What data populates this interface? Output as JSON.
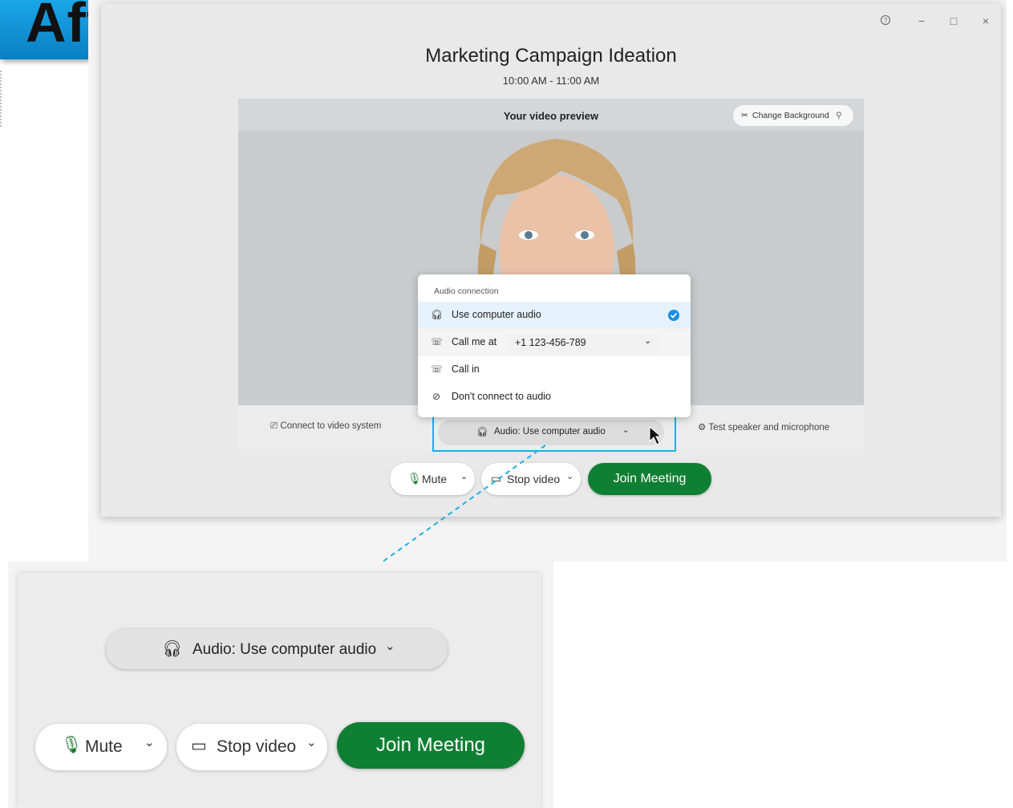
{
  "badge": {
    "text": "After"
  },
  "window": {
    "title": "Marketing Campaign Ideation",
    "time": "10:00 AM - 11:00 AM",
    "controls": {
      "help": "?",
      "minimize": "−",
      "maximize": "□",
      "close": "×"
    }
  },
  "preview": {
    "label": "Your video preview",
    "change_background": "Change Background",
    "connect_video": "Connect to video system",
    "audio_button": "Audio: Use computer audio",
    "test_speaker": "Test speaker and microphone"
  },
  "audio_menu": {
    "header": "Audio connection",
    "items": [
      {
        "label": "Use computer audio",
        "selected": true
      },
      {
        "label": "Call me at",
        "phone": "+1 123-456-789"
      },
      {
        "label": "Call in"
      },
      {
        "label": "Don't connect to audio"
      }
    ]
  },
  "actions": {
    "mute": "Mute",
    "stop_video": "Stop video",
    "join": "Join Meeting"
  },
  "zoom": {
    "audio_button": "Audio: Use computer audio",
    "mute": "Mute",
    "stop_video": "Stop video",
    "join": "Join Meeting"
  },
  "colors": {
    "accent_blue": "#1ab0e8",
    "join_green": "#0f7f33",
    "check_blue": "#1a8fe3"
  }
}
